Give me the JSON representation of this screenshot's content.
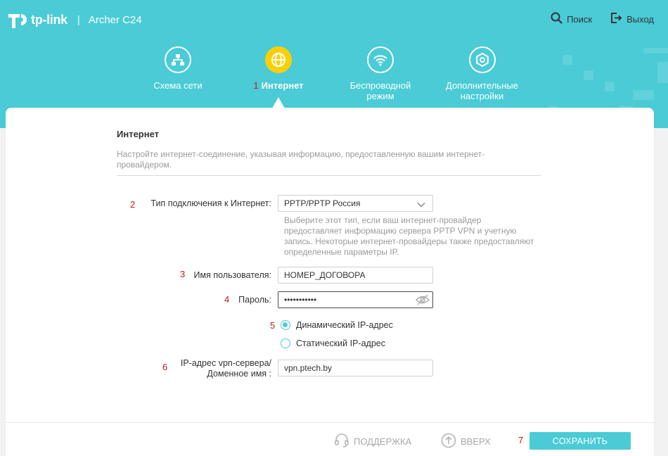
{
  "app": {
    "logo_text": "tp-link",
    "separator": "|",
    "model": "Archer C24"
  },
  "top_actions": {
    "search_label": "Поиск",
    "logout_label": "Выход"
  },
  "nav": {
    "items": [
      {
        "label": "Схема сети"
      },
      {
        "number": "1",
        "label": "Интернет"
      },
      {
        "label_line1": "Беспроводной",
        "label_line2": "режим"
      },
      {
        "label_line1": "Дополнительные",
        "label_line2": "настройки"
      }
    ]
  },
  "section": {
    "title": "Интернет",
    "description": "Настройте интернет-соединение, указывая информацию, предоставленную вашим интернет-провайдером."
  },
  "form": {
    "connection_type": {
      "number": "2",
      "label": "Тип подключения к Интернет:",
      "value": "PPTP/PPTP Россия",
      "hint": "Выберите этот тип, если ваш интернет-провайдер предоставляет информацию сервера PPTP VPN и учетную запись. Некоторые интернет-провайдеры также предоставляют определенные параметры IP."
    },
    "username": {
      "number": "3",
      "label": "Имя пользователя:",
      "value": "НОМЕР_ДОГОВОРА"
    },
    "password": {
      "number": "4",
      "label": "Пароль:",
      "value": "•••••••••••"
    },
    "ip_mode": {
      "number": "5",
      "options": [
        {
          "label": "Динамический IP-адрес",
          "checked": true
        },
        {
          "label": "Статический IP-адрес",
          "checked": false
        }
      ]
    },
    "vpn_server": {
      "number": "6",
      "label_line1": "IP-адрес vpn-сервера/",
      "label_line2": "Доменное имя :",
      "value": "vpn.ptech.by"
    }
  },
  "footer": {
    "support_label": "ПОДДЕРЖКА",
    "top_label": "ВВЕРХ",
    "save_number": "7",
    "save_label": "СОХРАНИТЬ"
  },
  "colors": {
    "accent": "#4acbd6",
    "active_tab": "#fccf05",
    "annotation": "#c0181f"
  }
}
